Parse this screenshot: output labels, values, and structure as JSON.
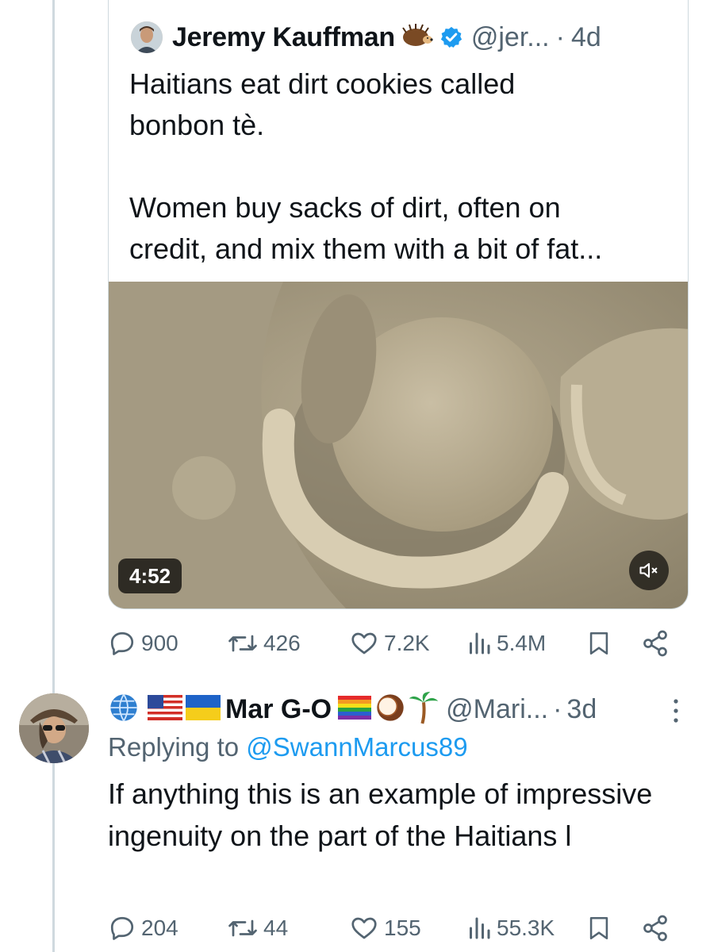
{
  "quoted_tweet": {
    "author_name": "Jeremy Kauffman",
    "name_emoji": "🦔",
    "handle": "@jer...",
    "dot": "·",
    "time": "4d",
    "text": "Haitians eat dirt cookies called\nbonbon tè.\n\nWomen buy sacks of dirt, often on\ncredit, and mix them with a bit of fat...",
    "video_duration": "4:52"
  },
  "quoted_actions": {
    "replies": "900",
    "reposts": "426",
    "likes": "7.2K",
    "views": "5.4M"
  },
  "reply_tweet": {
    "name_prefix_emoji": "🌐🇺🇸🇺🇦",
    "author_name": "Mar G-O",
    "name_suffix_emoji": "🏳️‍🌈🥥🌴",
    "handle": "@Mari...",
    "dot": "·",
    "time": "3d",
    "replying_label": "Replying to",
    "replying_to": "@SwannMarcus89",
    "text": "If anything this is an example of impressive ingenuity on the part of the Haitians l"
  },
  "reply_actions": {
    "replies": "204",
    "reposts": "44",
    "likes": "155",
    "views": "55.3K"
  },
  "colors": {
    "text": "#0f1419",
    "secondary": "#536471",
    "accent": "#1d9bf0",
    "border": "#cfd9de"
  },
  "icons": [
    "reply-icon",
    "repost-icon",
    "like-icon",
    "views-icon",
    "bookmark-icon",
    "share-icon",
    "verified-badge-icon",
    "mute-icon",
    "more-icon"
  ]
}
